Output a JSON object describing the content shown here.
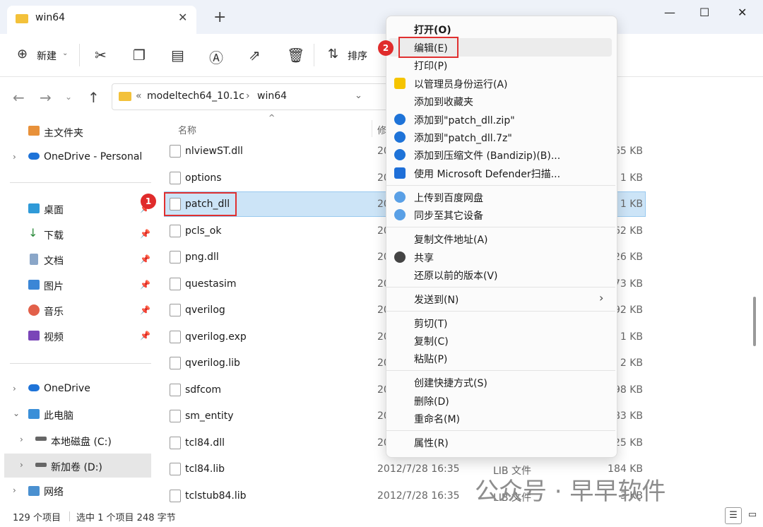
{
  "window": {
    "tab_title": "win64",
    "new_tab": "+",
    "close_tab": "✕",
    "min": "—",
    "max": "☐",
    "close": "✕"
  },
  "toolbar": {
    "new_label": "新建",
    "sort_label": "排序"
  },
  "address": {
    "prefix": "«",
    "crumb1": "modeltech64_10.1c",
    "sep": "›",
    "crumb2": "win64"
  },
  "sidebar": {
    "items": [
      {
        "label": "主文件夹"
      },
      {
        "label": "OneDrive - Personal"
      },
      {
        "label": "桌面"
      },
      {
        "label": "下载"
      },
      {
        "label": "文档"
      },
      {
        "label": "图片"
      },
      {
        "label": "音乐"
      },
      {
        "label": "视频"
      },
      {
        "label": "OneDrive"
      },
      {
        "label": "此电脑"
      },
      {
        "label": "本地磁盘 (C:)"
      },
      {
        "label": "新加卷 (D:)"
      },
      {
        "label": "网络"
      }
    ]
  },
  "list": {
    "col_name": "名称",
    "col_date": "修",
    "files": [
      {
        "name": "nlviewST.dll",
        "date": "20",
        "type": "",
        "size": "65 KB"
      },
      {
        "name": "options",
        "date": "20",
        "type": "",
        "size": "1 KB"
      },
      {
        "name": "patch_dll",
        "date": "20",
        "type": "",
        "size": "1 KB"
      },
      {
        "name": "pcls_ok",
        "date": "20",
        "type": "",
        "size": "62 KB"
      },
      {
        "name": "png.dll",
        "date": "20",
        "type": "",
        "size": "26 KB"
      },
      {
        "name": "questasim",
        "date": "20",
        "type": "",
        "size": "73 KB"
      },
      {
        "name": "qverilog",
        "date": "20",
        "type": "",
        "size": "92 KB"
      },
      {
        "name": "qverilog.exp",
        "date": "20",
        "type": "",
        "size": "1 KB"
      },
      {
        "name": "qverilog.lib",
        "date": "20",
        "type": "",
        "size": "2 KB"
      },
      {
        "name": "sdfcom",
        "date": "20",
        "type": "",
        "size": "98 KB"
      },
      {
        "name": "sm_entity",
        "date": "20",
        "type": "",
        "size": "83 KB"
      },
      {
        "name": "tcl84.dll",
        "date": "20",
        "type": "",
        "size": "25 KB"
      },
      {
        "name": "tcl84.lib",
        "date": "2012/7/28 16:35",
        "type": "LIB 文件",
        "size": "184 KB"
      },
      {
        "name": "tclstub84.lib",
        "date": "2012/7/28 16:35",
        "type": "LIB 文件",
        "size": "3 KB"
      }
    ]
  },
  "context_menu": {
    "items": [
      "打开(O)",
      "编辑(E)",
      "打印(P)",
      "以管理员身份运行(A)",
      "添加到收藏夹",
      "添加到\"patch_dll.zip\"",
      "添加到\"patch_dll.7z\"",
      "添加到压缩文件 (Bandizip)(B)...",
      "使用 Microsoft Defender扫描...",
      "上传到百度网盘",
      "同步至其它设备",
      "复制文件地址(A)",
      "共享",
      "还原以前的版本(V)",
      "发送到(N)",
      "剪切(T)",
      "复制(C)",
      "粘贴(P)",
      "创建快捷方式(S)",
      "删除(D)",
      "重命名(M)",
      "属性(R)"
    ],
    "submenu_arrow": "›"
  },
  "badges": {
    "b1": "1",
    "b2": "2"
  },
  "status": {
    "count": "129 个项目",
    "selected": "选中 1 个项目 248 字节"
  },
  "watermark": "公众号 · 早早软件",
  "colors": {
    "selection": "#cce4f7",
    "highlight_box": "#e03030",
    "folder": "#f3c13a",
    "accent": "#1e73d8"
  }
}
